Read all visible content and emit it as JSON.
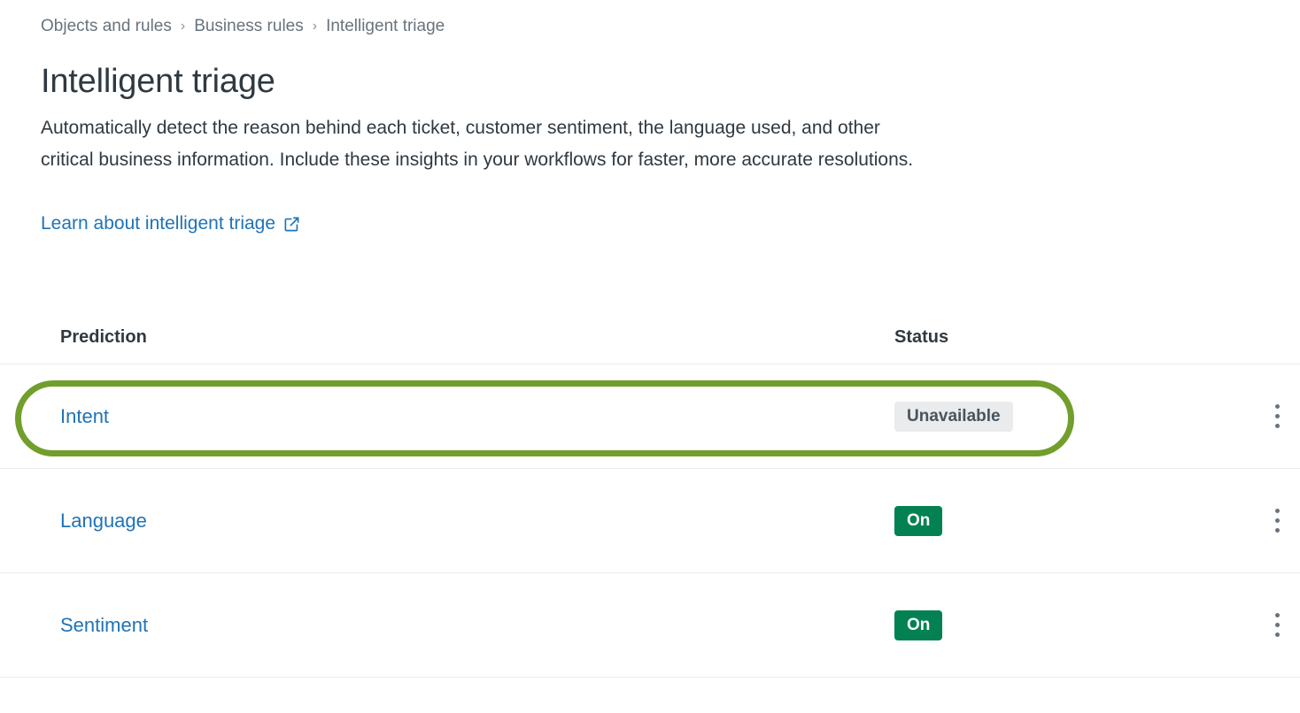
{
  "breadcrumb": {
    "items": [
      {
        "label": "Objects and rules",
        "current": false
      },
      {
        "label": "Business rules",
        "current": false
      },
      {
        "label": "Intelligent triage",
        "current": true
      }
    ],
    "separator": "›"
  },
  "page": {
    "title": "Intelligent triage",
    "description": "Automatically detect the reason behind each ticket, customer sentiment, the language used, and other critical business information. Include these insights in your workflows for faster, more accurate resolutions.",
    "learn_link_label": "Learn about intelligent triage",
    "learn_link_icon": "external-link-icon"
  },
  "table": {
    "columns": {
      "prediction": "Prediction",
      "status": "Status"
    },
    "rows": [
      {
        "prediction": "Intent",
        "status": "Unavailable",
        "status_variant": "unavailable",
        "highlighted": true,
        "menu_icon": "kebab-menu-icon"
      },
      {
        "prediction": "Language",
        "status": "On",
        "status_variant": "on",
        "highlighted": false,
        "menu_icon": "kebab-menu-icon"
      },
      {
        "prediction": "Sentiment",
        "status": "On",
        "status_variant": "on",
        "highlighted": false,
        "menu_icon": "kebab-menu-icon"
      }
    ]
  },
  "annotation": {
    "shape": "rounded-rect-outline",
    "target_row": "Intent",
    "color": "#719e2c"
  },
  "colors": {
    "link": "#1f73b7",
    "text": "#2f3941",
    "muted": "#68737d",
    "divider": "#e9ebed",
    "badge_on_bg": "#038153",
    "badge_on_text": "#ffffff",
    "badge_unavailable_bg": "#e9ebed",
    "badge_unavailable_text": "#49545c",
    "annotation": "#719e2c"
  }
}
